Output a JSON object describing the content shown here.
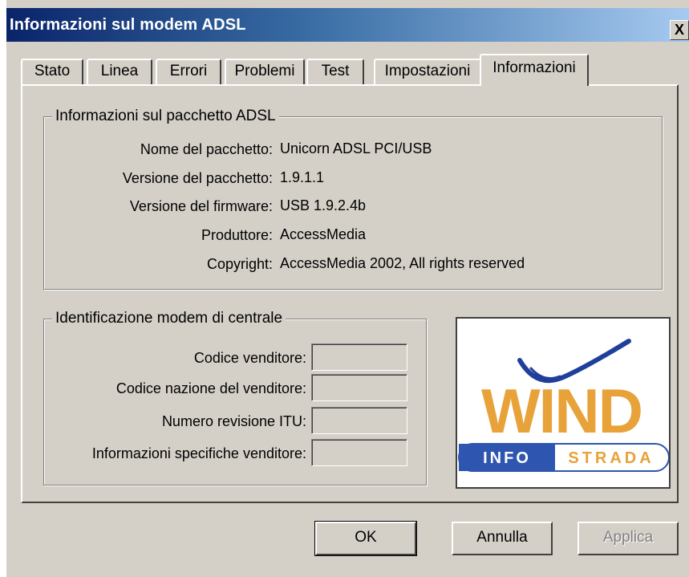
{
  "window": {
    "title": "Informazioni sul modem ADSL",
    "close_label": "X"
  },
  "tabs": [
    {
      "label": "Stato"
    },
    {
      "label": "Linea"
    },
    {
      "label": "Errori"
    },
    {
      "label": "Problemi"
    },
    {
      "label": "Test"
    },
    {
      "label": "Impostazioni"
    },
    {
      "label": "Informazioni",
      "active": true
    }
  ],
  "package_group": {
    "legend": "Informazioni sul pacchetto ADSL",
    "rows": [
      {
        "label": "Nome del pacchetto:",
        "value": "Unicorn ADSL PCI/USB"
      },
      {
        "label": "Versione del pacchetto:",
        "value": "1.9.1.1"
      },
      {
        "label": "Versione del firmware:",
        "value": "USB 1.9.2.4b"
      },
      {
        "label": "Produttore:",
        "value": "AccessMedia"
      },
      {
        "label": "Copyright:",
        "value": "AccessMedia 2002, All rights reserved"
      }
    ]
  },
  "modem_group": {
    "legend": "Identificazione modem di centrale",
    "rows": [
      {
        "label": "Codice venditore:",
        "value": ""
      },
      {
        "label": "Codice nazione del venditore:",
        "value": ""
      },
      {
        "label": "Numero revisione ITU:",
        "value": ""
      },
      {
        "label": "Informazioni specifiche venditore:",
        "value": ""
      }
    ]
  },
  "logo": {
    "wordmark": "WIND",
    "band_left": "INFO",
    "band_right": "STRADA",
    "colors": {
      "wind_orange": "#e8a23a",
      "swoosh_blue": "#1f3f9a",
      "band_blue": "#2e55b0",
      "strada_orange": "#e8a23a"
    }
  },
  "buttons": {
    "ok": "OK",
    "cancel": "Annulla",
    "apply": "Applica"
  }
}
